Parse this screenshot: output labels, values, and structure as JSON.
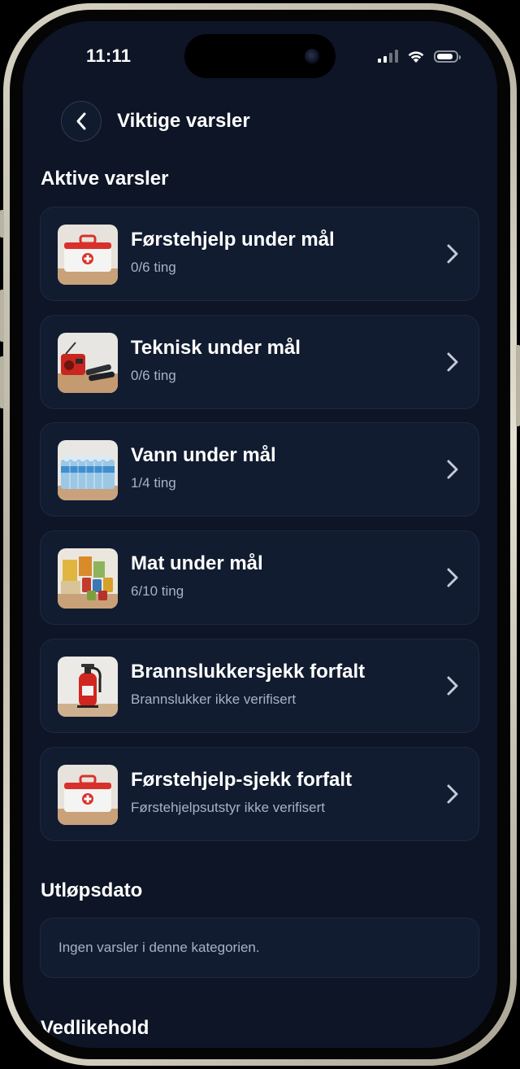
{
  "status_bar": {
    "time": "11:11"
  },
  "header": {
    "title": "Viktige varsler"
  },
  "sections": {
    "active_title": "Aktive varsler",
    "expiry_title": "Utløpsdato",
    "maintenance_title": "Vedlikehold"
  },
  "alerts": [
    {
      "title": "Førstehjelp under mål",
      "subtitle": "0/6 ting",
      "image": "first-aid-kit-image"
    },
    {
      "title": "Teknisk under mål",
      "subtitle": "0/6 ting",
      "image": "radio-flashlight-image"
    },
    {
      "title": "Vann under mål",
      "subtitle": "1/4 ting",
      "image": "water-bottles-image"
    },
    {
      "title": "Mat under mål",
      "subtitle": "6/10 ting",
      "image": "canned-food-image"
    },
    {
      "title": "Brannslukkersjekk forfalt",
      "subtitle": "Brannslukker ikke verifisert",
      "image": "fire-extinguisher-image"
    },
    {
      "title": "Førstehjelp-sjekk forfalt",
      "subtitle": "Førstehjelpsutstyr ikke verifisert",
      "image": "first-aid-kit-image"
    }
  ],
  "expiry": {
    "empty_text": "Ingen varsler i denne kategorien."
  },
  "colors": {
    "background": "#0d1526",
    "card": "#121c30",
    "muted_text": "#a8b2c6"
  }
}
